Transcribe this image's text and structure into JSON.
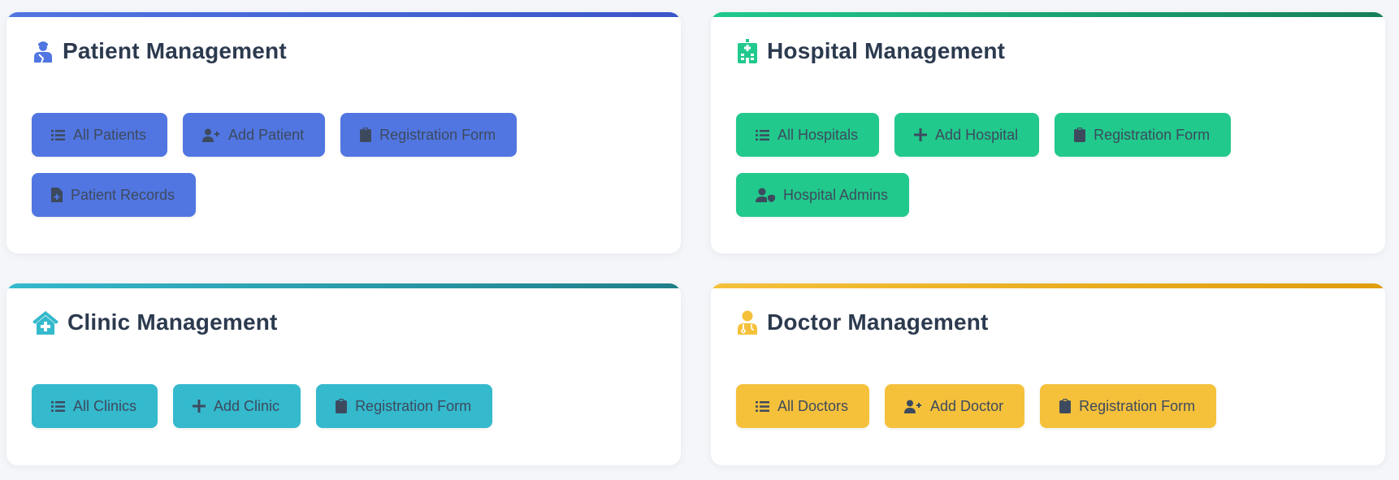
{
  "colors": {
    "patient": "#5176e1",
    "patient_bar": "#3f5fd6",
    "hospital": "#21c98c",
    "hospital_bar": "#168a5e",
    "clinic": "#34b9cd",
    "clinic_bar": "#218590",
    "doctor": "#f5c13b",
    "doctor_bar": "#e4a30f"
  },
  "cards": {
    "patient": {
      "title": "Patient Management",
      "icon": "patient-icon",
      "buttons": [
        {
          "label": "All Patients",
          "icon": "list-icon"
        },
        {
          "label": "Add Patient",
          "icon": "user-plus-icon"
        },
        {
          "label": "Registration Form",
          "icon": "clipboard-icon"
        },
        {
          "label": "Patient Records",
          "icon": "file-medical-icon"
        }
      ]
    },
    "hospital": {
      "title": "Hospital Management",
      "icon": "hospital-icon",
      "buttons": [
        {
          "label": "All Hospitals",
          "icon": "list-icon"
        },
        {
          "label": "Add Hospital",
          "icon": "plus-icon"
        },
        {
          "label": "Registration Form",
          "icon": "clipboard-icon"
        },
        {
          "label": "Hospital Admins",
          "icon": "user-shield-icon"
        }
      ]
    },
    "clinic": {
      "title": "Clinic Management",
      "icon": "clinic-icon",
      "buttons": [
        {
          "label": "All Clinics",
          "icon": "list-icon"
        },
        {
          "label": "Add Clinic",
          "icon": "plus-icon"
        },
        {
          "label": "Registration Form",
          "icon": "clipboard-icon"
        }
      ]
    },
    "doctor": {
      "title": "Doctor Management",
      "icon": "doctor-icon",
      "buttons": [
        {
          "label": "All Doctors",
          "icon": "list-icon"
        },
        {
          "label": "Add Doctor",
          "icon": "user-plus-icon"
        },
        {
          "label": "Registration Form",
          "icon": "clipboard-icon"
        }
      ]
    }
  }
}
